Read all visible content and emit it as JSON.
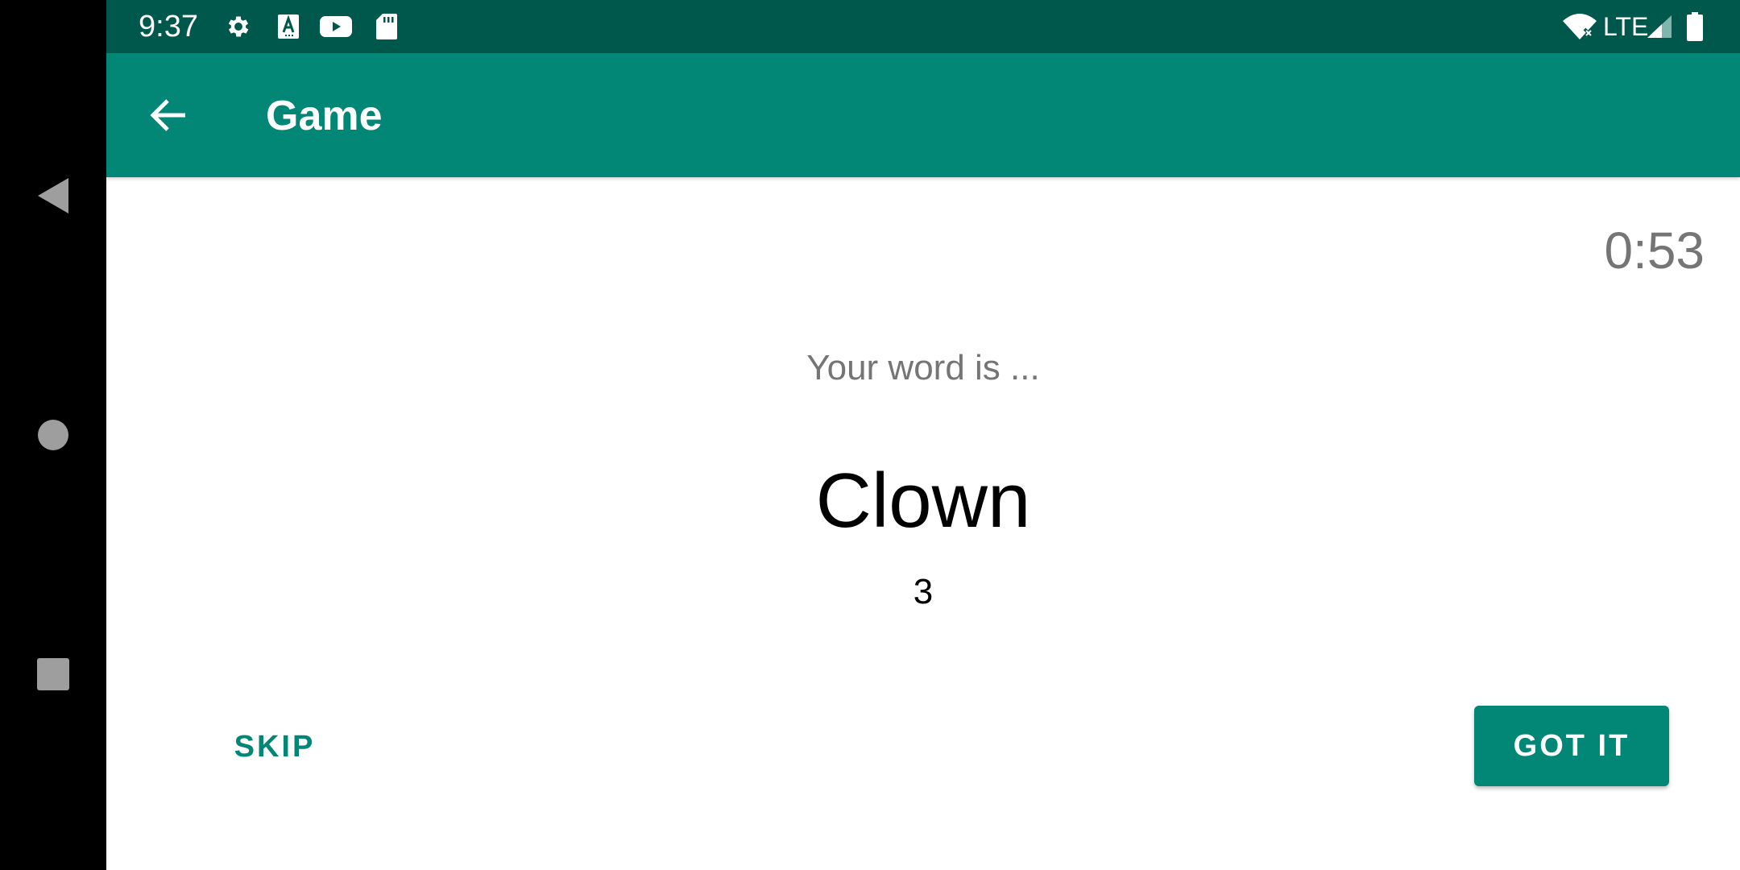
{
  "status_bar": {
    "time": "9:37",
    "network_label": "LTE",
    "left_icons": [
      "gear-icon",
      "text-a-icon",
      "youtube-icon",
      "sd-card-icon"
    ],
    "right_icons": [
      "wifi-off-icon",
      "signal-icon",
      "battery-icon"
    ]
  },
  "app_bar": {
    "title": "Game",
    "back_icon": "arrow-back-icon"
  },
  "game": {
    "timer": "0:53",
    "prompt": "Your word is ...",
    "word": "Clown",
    "score": "3"
  },
  "actions": {
    "skip_label": "SKIP",
    "got_it_label": "GOT IT"
  },
  "nav_bar": {
    "buttons": [
      "back-triangle-icon",
      "home-circle-icon",
      "recents-square-icon"
    ]
  },
  "colors": {
    "primary": "#028675",
    "primary_dark": "#00574b",
    "secondary_text": "#757575"
  }
}
